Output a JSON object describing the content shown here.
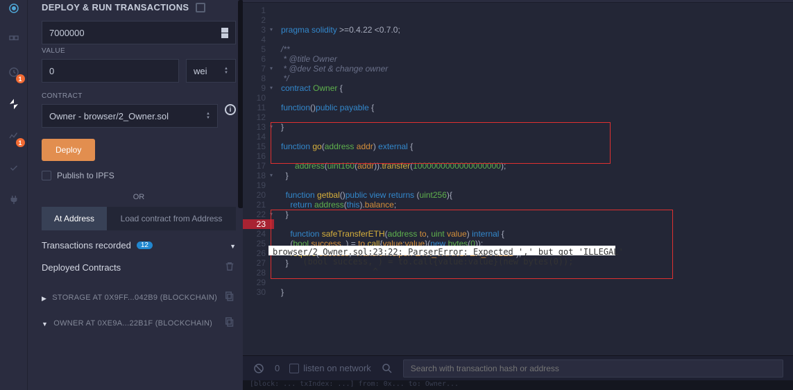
{
  "rail": {
    "badges": {
      "compile": "1",
      "analysis": "1"
    }
  },
  "panel": {
    "title": "DEPLOY & RUN TRANSACTIONS",
    "gas": "7000000",
    "value_label": "VALUE",
    "value": "0",
    "unit": "wei",
    "contract_label": "CONTRACT",
    "contract": "Owner - browser/2_Owner.sol",
    "deploy_btn": "Deploy",
    "publish": "Publish to IPFS",
    "or": "OR",
    "at_address": "At Address",
    "load_addr": "Load contract from Address",
    "tx_recorded": "Transactions recorded",
    "tx_count": "12",
    "deployed": "Deployed Contracts",
    "items": [
      {
        "dir": "right",
        "text": "STORAGE AT 0X9FF...042B9 (BLOCKCHAIN)"
      },
      {
        "dir": "down",
        "text": "OWNER AT 0XE9A...22B1F (BLOCKCHAIN)"
      }
    ]
  },
  "gutter": {
    "folds": [
      3,
      7,
      9,
      13,
      18,
      22
    ],
    "error_line": 23,
    "max": 30
  },
  "code": {
    "lines": [
      {
        "t": "pragma",
        "h": "<span class='kw'>pragma</span> <span class='kw'>solidity</span> &gt;=0.4.22 &lt;0.7.0;"
      },
      {
        "t": "",
        "h": ""
      },
      {
        "t": "/**",
        "h": "<span class='cm'>/**</span>"
      },
      {
        "t": " * @title Owner",
        "h": "<span class='cm'> * @title Owner</span>"
      },
      {
        "t": " * @dev Set & change owner",
        "h": "<span class='cm'> * @dev Set &amp; change owner</span>"
      },
      {
        "t": " */",
        "h": "<span class='cm'> */</span>"
      },
      {
        "t": "contract Owner {",
        "h": "<span class='kw'>contract</span> <span class='typ'>Owner</span> {"
      },
      {
        "t": "",
        "h": ""
      },
      {
        "t": "function()public payable {",
        "h": "<span class='kw'>function</span>()<span class='kw'>public</span> <span class='kw'>payable</span> {"
      },
      {
        "t": "",
        "h": ""
      },
      {
        "t": "}",
        "h": "}"
      },
      {
        "t": "",
        "h": ""
      },
      {
        "t": "function go(address addr) external {",
        "h": "<span class='kw'>function</span> <span class='fn'>go</span>(<span class='typ'>address</span> <span class='str'>addr</span>) <span class='kw'>external</span> {"
      },
      {
        "t": "",
        "h": ""
      },
      {
        "t": "      address(uint160(addr)).transfer(1000000000000000000);",
        "h": "      <span class='typ'>address</span>(<span class='typ'>uint160</span>(<span class='str'>addr</span>)).<span class='fn'>transfer</span>(<span class='num'>1000000000000000000</span>);"
      },
      {
        "t": "  }",
        "h": "  }"
      },
      {
        "t": "",
        "h": ""
      },
      {
        "t": "  function getbal()public view returns (uint256){",
        "h": "  <span class='kw'>function</span> <span class='fn'>getbal</span>()<span class='kw'>public</span> <span class='kw'>view</span> <span class='kw'>returns</span> (<span class='typ'>uint256</span>){"
      },
      {
        "t": "    return address(this).balance;",
        "h": "    <span class='kw'>return</span> <span class='typ'>address</span>(<span class='kw'>this</span>).<span class='str'>balance</span>;"
      },
      {
        "t": "  }",
        "h": "  }"
      },
      {
        "t": "",
        "h": ""
      },
      {
        "t": "    function safeTransferETH(address to, uint value) internal {",
        "h": "    <span class='kw'>function</span> <span class='fn'>safeTransferETH</span>(<span class='typ'>address</span> <span class='str'>to</span>, <span class='typ'>uint</span> <span class='str'>value</span>) <span class='kw'>internal</span> {"
      },
      {
        "t": "    (bool success, ) = to.call{value:value}(new bytes(0));",
        "h": "    (<span class='typ'>bool</span> <span class='str'>success</span>, ) = <span class='str'>to</span>.<span class='fn'>call</span>{<span class='str'>value</span>:<span class='str'>value</span>}(<span class='kw'>new</span> <span class='typ'>bytes</span>(<span class='num'>0</span>));"
      },
      {
        "t": "    require(success, 'TransferHelper: ETH_TRANSFER_FAILED');",
        "h": "    <span class='fn'>require</span>(<span class='str'>success</span>, <span class='str'>'TransferHelper: ETH_TRANSFER_FAILED'</span>);"
      },
      {
        "t": "  }",
        "h": "  }"
      },
      {
        "t": "",
        "h": ""
      },
      {
        "t": "",
        "h": ""
      },
      {
        "t": "}",
        "h": "}"
      },
      {
        "t": "",
        "h": ""
      },
      {
        "t": "",
        "h": ""
      }
    ]
  },
  "error_tip": "browser/2_Owner.sol:23:22: ParserError: Expected ',' but got 'ILLEGAL'\n      (bool success, ) = to.call{value:value}(new bytes(0));\n                    ^",
  "console": {
    "zero": "0",
    "listen": "listen on network",
    "search_ph": "Search with transaction hash or address"
  }
}
